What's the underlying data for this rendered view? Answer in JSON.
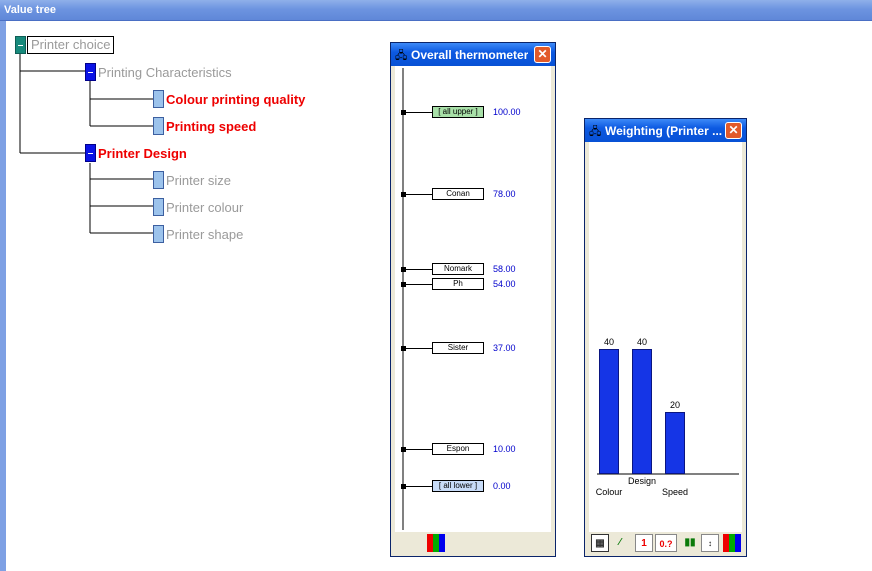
{
  "window": {
    "title": "Value tree"
  },
  "tree": {
    "root": "Printer choice",
    "nodes": {
      "printing_characteristics": "Printing Characteristics",
      "colour_printing_quality": "Colour printing quality",
      "printing_speed": "Printing speed",
      "printer_design": "Printer Design",
      "printer_size": "Printer size",
      "printer_colour": "Printer colour",
      "printer_shape": "Printer shape"
    }
  },
  "thermometer": {
    "title": "Overall thermometer",
    "items": [
      {
        "label": "[ all upper ]",
        "value": "100.00"
      },
      {
        "label": "Conan",
        "value": "78.00"
      },
      {
        "label": "Nomark",
        "value": "58.00"
      },
      {
        "label": "Ph",
        "value": "54.00"
      },
      {
        "label": "Sister",
        "value": "37.00"
      },
      {
        "label": "Espon",
        "value": "10.00"
      },
      {
        "label": "[ all lower ]",
        "value": "0.00"
      }
    ]
  },
  "weighting": {
    "title": "Weighting (Printer ...",
    "toolbar": {
      "btn_one": "1",
      "btn_question": "0.?"
    },
    "chart_data": {
      "type": "bar",
      "categories": [
        "Colour",
        "Design",
        "Speed"
      ],
      "values": [
        40,
        40,
        20
      ],
      "ylim": [
        0,
        100
      ],
      "bar_color": "#1535e6"
    }
  },
  "colors": {
    "accent_red": "#ee0000",
    "title_blue": "#0c59e1",
    "value_blue": "#0000cc"
  }
}
